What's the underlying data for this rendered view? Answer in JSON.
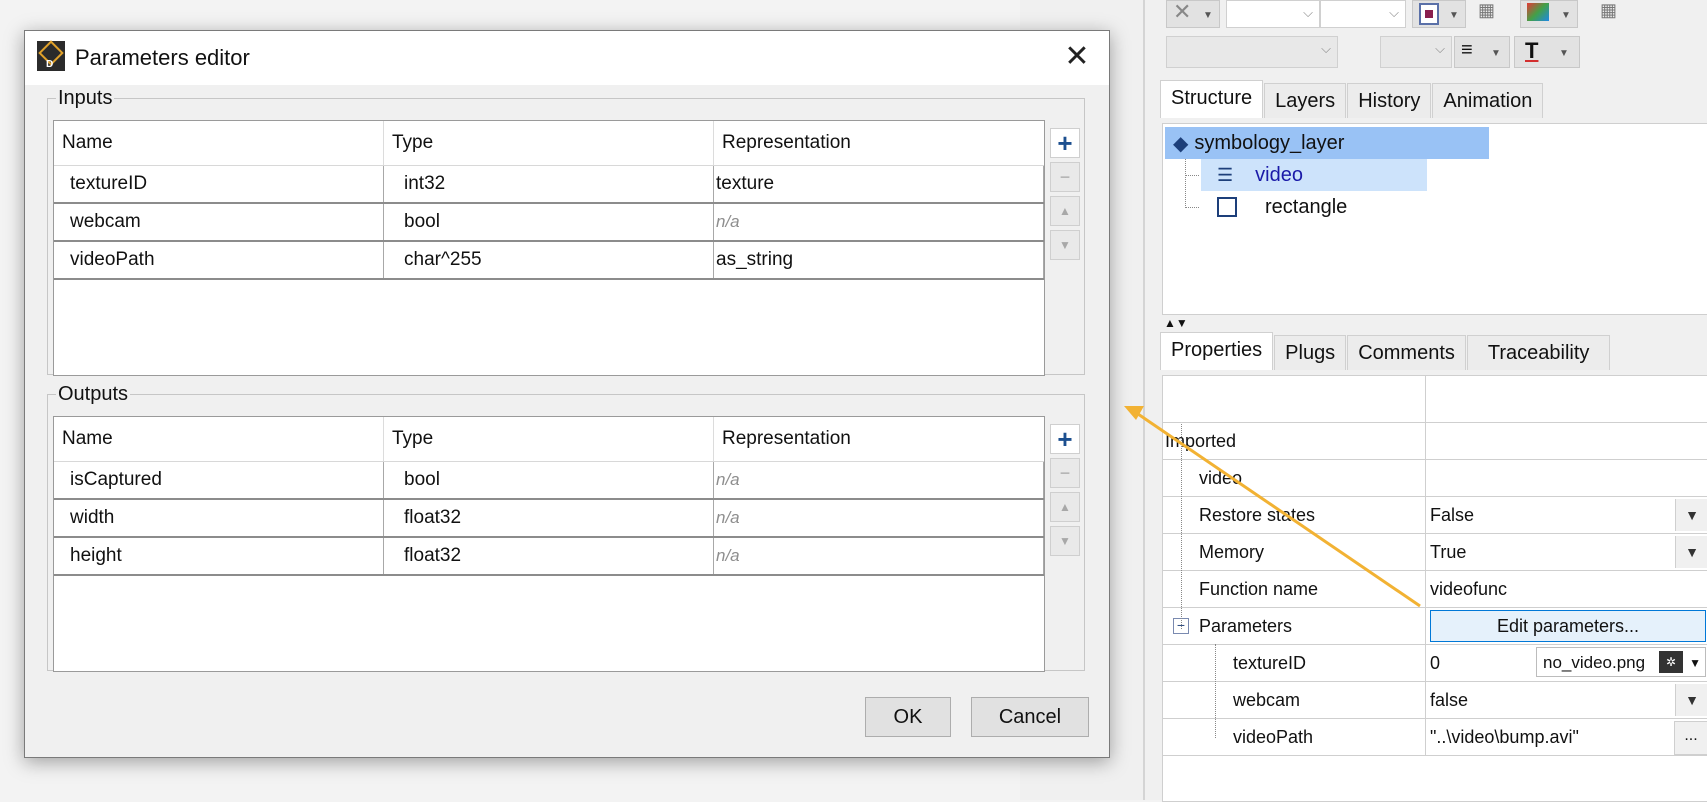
{
  "dialog": {
    "title": "Parameters editor",
    "close_icon": "close-icon",
    "inputs": {
      "legend": "Inputs",
      "columns": [
        "Name",
        "Type",
        "Representation"
      ],
      "rows": [
        {
          "name": "textureID",
          "type": "int32",
          "representation": "texture"
        },
        {
          "name": "webcam",
          "type": "bool",
          "representation": "n/a"
        },
        {
          "name": "videoPath",
          "type": "char^255",
          "representation": "as_string"
        }
      ]
    },
    "outputs": {
      "legend": "Outputs",
      "columns": [
        "Name",
        "Type",
        "Representation"
      ],
      "rows": [
        {
          "name": "isCaptured",
          "type": "bool",
          "representation": "n/a"
        },
        {
          "name": "width",
          "type": "float32",
          "representation": "n/a"
        },
        {
          "name": "height",
          "type": "float32",
          "representation": "n/a"
        }
      ]
    },
    "side_buttons": {
      "add": "+",
      "remove": "−",
      "up": "▲",
      "down": "▼"
    },
    "ok_label": "OK",
    "cancel_label": "Cancel"
  },
  "structure_tabs": [
    "Structure",
    "Layers",
    "History",
    "Animation"
  ],
  "tree": {
    "root": "symbology_layer",
    "children": [
      "video",
      "rectangle"
    ]
  },
  "property_tabs": [
    "Properties",
    "Plugs",
    "Comments",
    "Traceability"
  ],
  "properties": {
    "imported_label": "Imported",
    "video_label": "video",
    "rows": [
      {
        "name": "Restore states",
        "value": "False"
      },
      {
        "name": "Memory",
        "value": "True"
      },
      {
        "name": "Function name",
        "value": "videofunc"
      }
    ],
    "parameters_label": "Parameters",
    "edit_parameters_label": "Edit parameters...",
    "params": [
      {
        "name": "textureID",
        "value": "0",
        "extra": "no_video.png"
      },
      {
        "name": "webcam",
        "value": "false"
      },
      {
        "name": "videoPath",
        "value": "\"..\\video\\bump.avi\"",
        "button": "..."
      }
    ]
  },
  "colors": {
    "accent_arrow": "#f2b233",
    "selection": "#99c2f5",
    "plus_icon": "#1c4f8f"
  }
}
